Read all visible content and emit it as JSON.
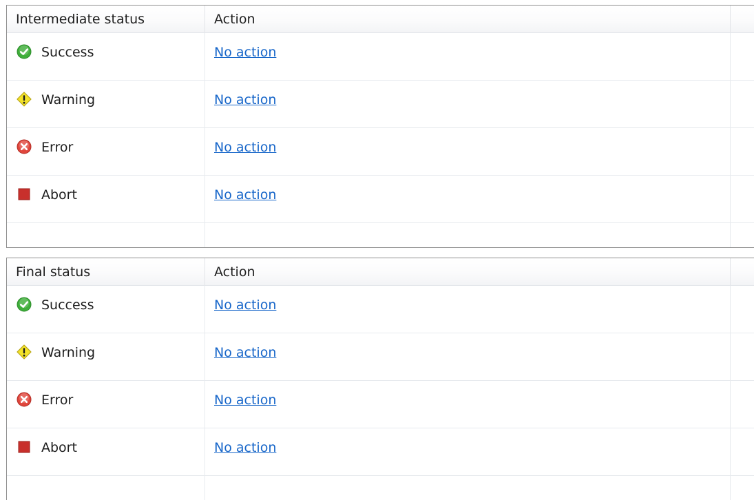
{
  "intermediate": {
    "header": {
      "status": "Intermediate status",
      "action": "Action"
    },
    "rows": [
      {
        "icon": "success-icon",
        "label": "Success",
        "action": "No action"
      },
      {
        "icon": "warning-icon",
        "label": "Warning",
        "action": "No action"
      },
      {
        "icon": "error-icon",
        "label": "Error",
        "action": "No action"
      },
      {
        "icon": "abort-icon",
        "label": "Abort",
        "action": "No action"
      }
    ]
  },
  "final": {
    "header": {
      "status": "Final status",
      "action": "Action"
    },
    "rows": [
      {
        "icon": "success-icon",
        "label": "Success",
        "action": "No action"
      },
      {
        "icon": "warning-icon",
        "label": "Warning",
        "action": "No action"
      },
      {
        "icon": "error-icon",
        "label": "Error",
        "action": "No action"
      },
      {
        "icon": "abort-icon",
        "label": "Abort",
        "action": "No action"
      }
    ]
  },
  "colors": {
    "link": "#1766c9",
    "success": "#3fae3a",
    "warning": "#f3e32a",
    "error": "#e0463c",
    "abort": "#c8302c",
    "border": "#8f8f8f"
  }
}
